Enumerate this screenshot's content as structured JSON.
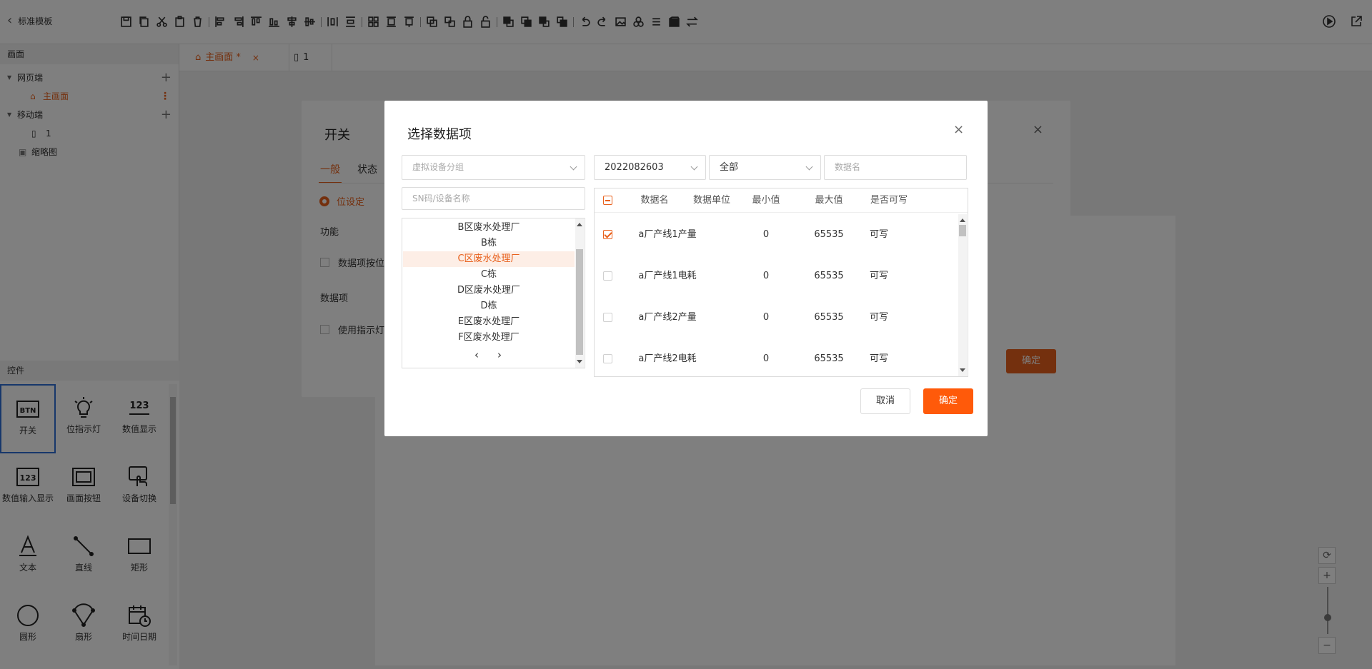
{
  "app": {
    "back_label": "标准模板"
  },
  "sidebar": {
    "screen_header": "画面",
    "tree": [
      {
        "label": "网页端",
        "type": "group"
      },
      {
        "label": "主画面",
        "type": "page",
        "active": true
      },
      {
        "label": "移动端",
        "type": "group"
      },
      {
        "label": "1",
        "type": "mobile-page"
      },
      {
        "label": "缩略图",
        "type": "thumb"
      }
    ],
    "controls_header": "控件",
    "controls": [
      {
        "label": "开关",
        "icon": "btn-icon",
        "selected": true
      },
      {
        "label": "位指示灯",
        "icon": "bulb-icon"
      },
      {
        "label": "数值显示",
        "icon": "number-display-icon"
      },
      {
        "label": "数值输入显示",
        "icon": "number-input-icon"
      },
      {
        "label": "画面按钮",
        "icon": "screen-button-icon"
      },
      {
        "label": "设备切换",
        "icon": "device-switch-icon"
      },
      {
        "label": "文本",
        "icon": "text-icon"
      },
      {
        "label": "直线",
        "icon": "line-icon"
      },
      {
        "label": "矩形",
        "icon": "rect-icon"
      },
      {
        "label": "圆形",
        "icon": "circle-icon"
      },
      {
        "label": "扇形",
        "icon": "sector-icon"
      },
      {
        "label": "时间日期",
        "icon": "calendar-icon"
      }
    ]
  },
  "tabs": [
    {
      "label": "主画面 *",
      "active": true
    },
    {
      "label": "1",
      "active": false
    }
  ],
  "prop_dialog": {
    "title": "开关",
    "tabs": [
      "一般",
      "状态"
    ],
    "radio_label": "位设定",
    "function_label": "功能",
    "checkbox1_label": "数据项按位",
    "dataitem_label": "数据项",
    "checkbox2_label": "使用指示灯",
    "ok_label": "确定"
  },
  "dialog": {
    "title": "选择数据项",
    "group_placeholder": "虚拟设备分组",
    "device_value": "2022082603",
    "filter_value": "全部",
    "dataname_placeholder": "数据名",
    "sn_placeholder": "SN码/设备名称",
    "tree_items": [
      {
        "label": "B区废水处理厂",
        "highlight": false
      },
      {
        "label": "B栋",
        "highlight": false
      },
      {
        "label": "C区废水处理厂",
        "highlight": true
      },
      {
        "label": "C栋",
        "highlight": false
      },
      {
        "label": "D区废水处理厂",
        "highlight": false
      },
      {
        "label": "D栋",
        "highlight": false
      },
      {
        "label": "E区废水处理厂",
        "highlight": false
      },
      {
        "label": "F区废水处理厂",
        "highlight": false
      }
    ],
    "pager_prev": "‹",
    "pager_next": "›",
    "columns": [
      "数据名",
      "数据单位",
      "最小值",
      "最大值",
      "是否可写"
    ],
    "rows": [
      {
        "checked": true,
        "name": "a厂产线1产量",
        "unit": "",
        "min": "0",
        "max": "65535",
        "writable": "可写"
      },
      {
        "checked": false,
        "name": "a厂产线1电耗",
        "unit": "",
        "min": "0",
        "max": "65535",
        "writable": "可写"
      },
      {
        "checked": false,
        "name": "a厂产线2产量",
        "unit": "",
        "min": "0",
        "max": "65535",
        "writable": "可写"
      },
      {
        "checked": false,
        "name": "a厂产线2电耗",
        "unit": "",
        "min": "0",
        "max": "65535",
        "writable": "可写"
      }
    ],
    "cancel_label": "取消",
    "ok_label": "确定"
  },
  "colors": {
    "accent": "#e8601c",
    "primary_button": "#ff5a0a",
    "selected_border": "#2f6fd6"
  }
}
